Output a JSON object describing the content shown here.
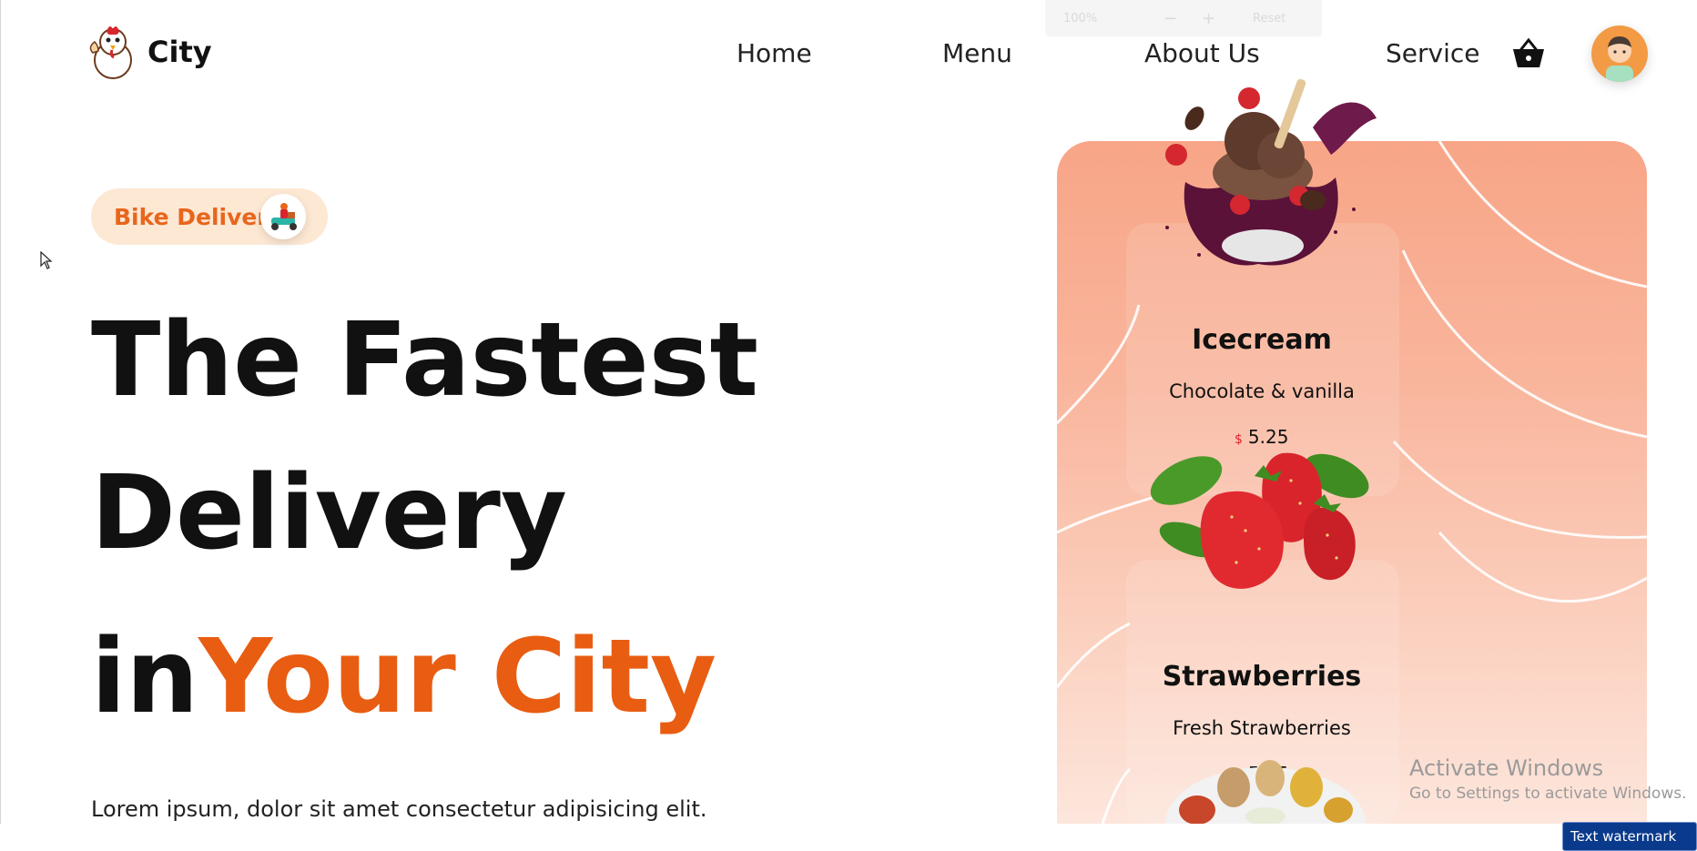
{
  "brand": {
    "name": "City"
  },
  "nav": {
    "items": [
      {
        "label": "Home"
      },
      {
        "label": "Menu"
      },
      {
        "label": "About Us"
      },
      {
        "label": "Service"
      }
    ]
  },
  "zoom_toolbar": {
    "zoom": "100%",
    "minus": "−",
    "plus": "+",
    "reset": "Reset"
  },
  "hero": {
    "badge": "Bike Delivery",
    "headline_line1": "The Fastest",
    "headline_line2": "Delivery",
    "headline_in": "in",
    "headline_accent": "Your City",
    "description": "Lorem ipsum, dolor sit amet consectetur adipisicing elit."
  },
  "menu_items": [
    {
      "name": "Icecream",
      "description": "Chocolate & vanilla",
      "currency": "$",
      "price": "5.25"
    },
    {
      "name": "Strawberries",
      "description": "Fresh Strawberries",
      "currency": "$",
      "price": "5.25"
    }
  ],
  "system": {
    "activate_title": "Activate Windows",
    "activate_sub": "Go to Settings to activate Windows.",
    "watermark_button": "Text watermark"
  },
  "colors": {
    "accent": "#e85d12",
    "badge_bg": "#fde8d4",
    "card_top": "#f8a587",
    "card_bottom": "#fde6dc"
  },
  "icons": [
    "chicken-logo-icon",
    "basket-icon",
    "avatar-icon",
    "scooter-icon",
    "cursor-icon"
  ]
}
